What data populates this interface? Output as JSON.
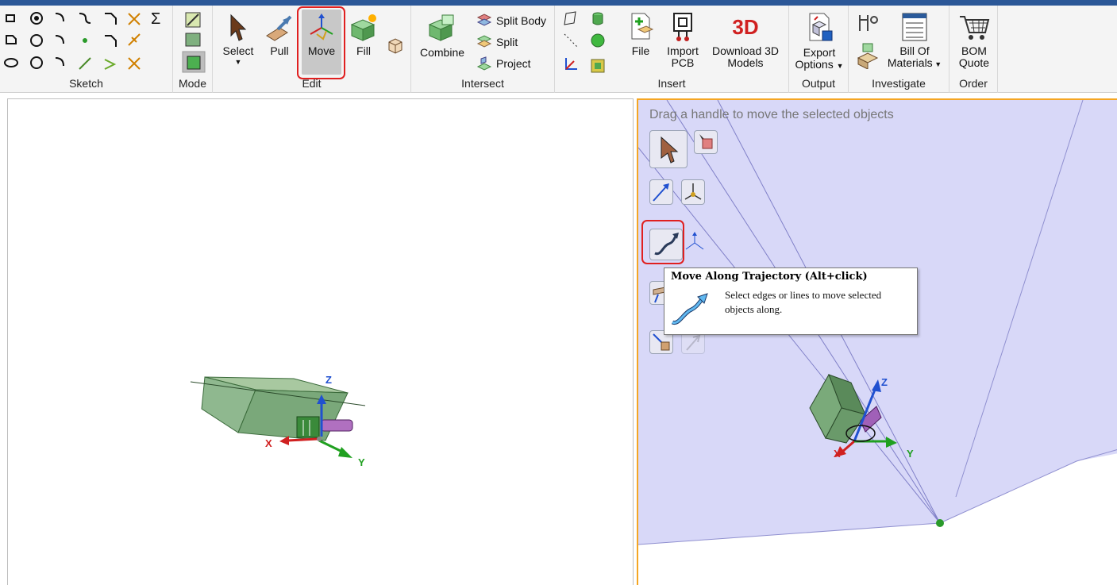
{
  "ribbon": {
    "groups": {
      "sketch": "Sketch",
      "mode": "Mode",
      "edit": "Edit",
      "intersect": "Intersect",
      "insert": "Insert",
      "output": "Output",
      "investigate": "Investigate",
      "order": "Order"
    },
    "tools": {
      "select": "Select",
      "pull": "Pull",
      "move": "Move",
      "fill": "Fill",
      "combine": "Combine",
      "split_body": "Split Body",
      "split": "Split",
      "project": "Project",
      "file": "File",
      "import_pcb_1": "Import",
      "import_pcb_2": "PCB",
      "download_3d_1": "Download 3D",
      "download_3d_2": "Models",
      "export_1": "Export",
      "export_2": "Options",
      "bom_1": "Bill Of",
      "bom_2": "Materials",
      "quote_1": "BOM",
      "quote_2": "Quote",
      "sigma": "Σ",
      "download_badge": "3D"
    }
  },
  "viewport_right": {
    "hint": "Drag a handle to move the selected objects"
  },
  "tooltip": {
    "title": "Move Along Trajectory (Alt+click)",
    "body": "Select edges or lines to move selected objects along."
  },
  "axes": {
    "x": "X",
    "y": "Y",
    "z": "Z"
  },
  "colors": {
    "accent_border": "#f5a623",
    "highlight": "#e02020",
    "title_strip": "#2b5797",
    "model_green": "#8fb88f",
    "plane_fill": "#d8d8f8"
  }
}
